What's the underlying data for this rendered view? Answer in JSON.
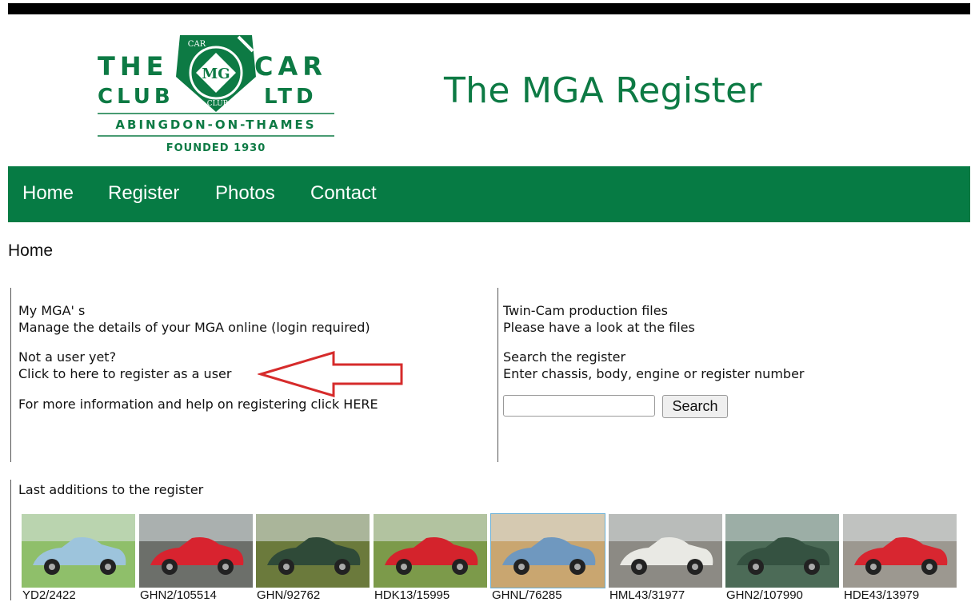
{
  "logo": {
    "line1_left": "THE",
    "line1_right": "CAR",
    "line2_left": "CLUB",
    "line2_right": "LTD",
    "badge_top": "CAR",
    "badge_center": "MG",
    "badge_bottom": "CLUB",
    "location": "ABINGDON-ON-THAMES",
    "founded": "FOUNDED 1930"
  },
  "site_title": "The MGA Register",
  "nav": {
    "items": [
      "Home",
      "Register",
      "Photos",
      "Contact"
    ]
  },
  "breadcrumb": "Home",
  "left_panel": {
    "my_mgas_title": "My MGA' s",
    "my_mgas_desc": "Manage the details of your MGA online (login required)",
    "not_user_title": "Not a user yet?",
    "not_user_desc": "Click to here to register as a user",
    "more_info": "For more information and help on registering click HERE"
  },
  "right_panel": {
    "twincam_title": "Twin-Cam production files",
    "twincam_desc": "Please have a look at the files",
    "search_title": "Search the register",
    "search_desc": "Enter chassis, body, engine or register number",
    "search_value": "",
    "search_button": "Search"
  },
  "last_additions": {
    "heading": "Last additions to the register",
    "items": [
      {
        "label": "YD2/2422",
        "car_color": "#9dc4dc",
        "bg": "#8fbf6a"
      },
      {
        "label": "GHN2/105514",
        "car_color": "#d8232f",
        "bg": "#6c6f6a"
      },
      {
        "label": "GHN/92762",
        "car_color": "#2f4a38",
        "bg": "#6b7a3c"
      },
      {
        "label": "HDK13/15995",
        "car_color": "#d4232c",
        "bg": "#7c9a4a"
      },
      {
        "label": "GHNL/76285",
        "car_color": "#6f98bf",
        "bg": "#c9a670"
      },
      {
        "label": "HML43/31977",
        "car_color": "#e9e9e4",
        "bg": "#8c8a84"
      },
      {
        "label": "GHN2/107990",
        "car_color": "#355241",
        "bg": "#4c6b57"
      },
      {
        "label": "HDE43/13979",
        "car_color": "#d82630",
        "bg": "#9c9890"
      }
    ]
  },
  "colors": {
    "brand_green": "#067b44",
    "title_green": "#0d7a44",
    "arrow_red": "#d62b2b"
  }
}
